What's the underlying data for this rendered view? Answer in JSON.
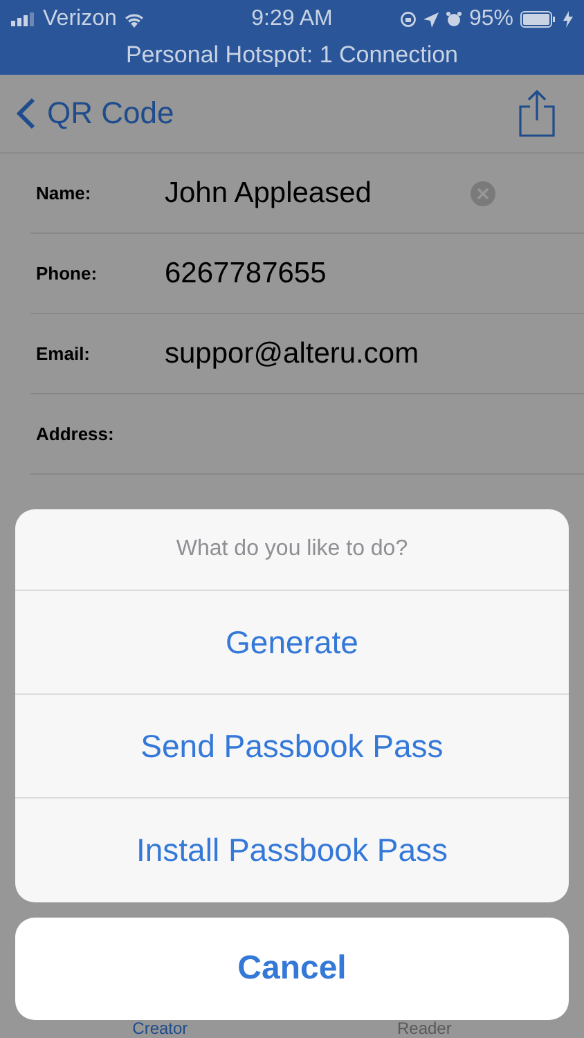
{
  "status_bar": {
    "carrier": "Verizon",
    "time": "9:29 AM",
    "battery": "95%"
  },
  "hotspot_banner": "Personal Hotspot: 1 Connection",
  "nav": {
    "back_label": "QR Code"
  },
  "fields": [
    {
      "label": "Name:",
      "value": "John Appleased",
      "clear_button": true
    },
    {
      "label": "Phone:",
      "value": "6267787655",
      "clear_button": false
    },
    {
      "label": "Email:",
      "value": "suppor@alteru.com",
      "clear_button": false
    },
    {
      "label": "Address:",
      "clear_button": false
    }
  ],
  "tab_bar": [
    {
      "label": "Creator",
      "selected": true
    },
    {
      "label": "Reader",
      "selected": false
    }
  ],
  "action_sheet": {
    "title": "What do you like to do?",
    "actions": [
      "Generate",
      "Send Passbook Pass",
      "Install Passbook Pass"
    ],
    "cancel": "Cancel"
  }
}
